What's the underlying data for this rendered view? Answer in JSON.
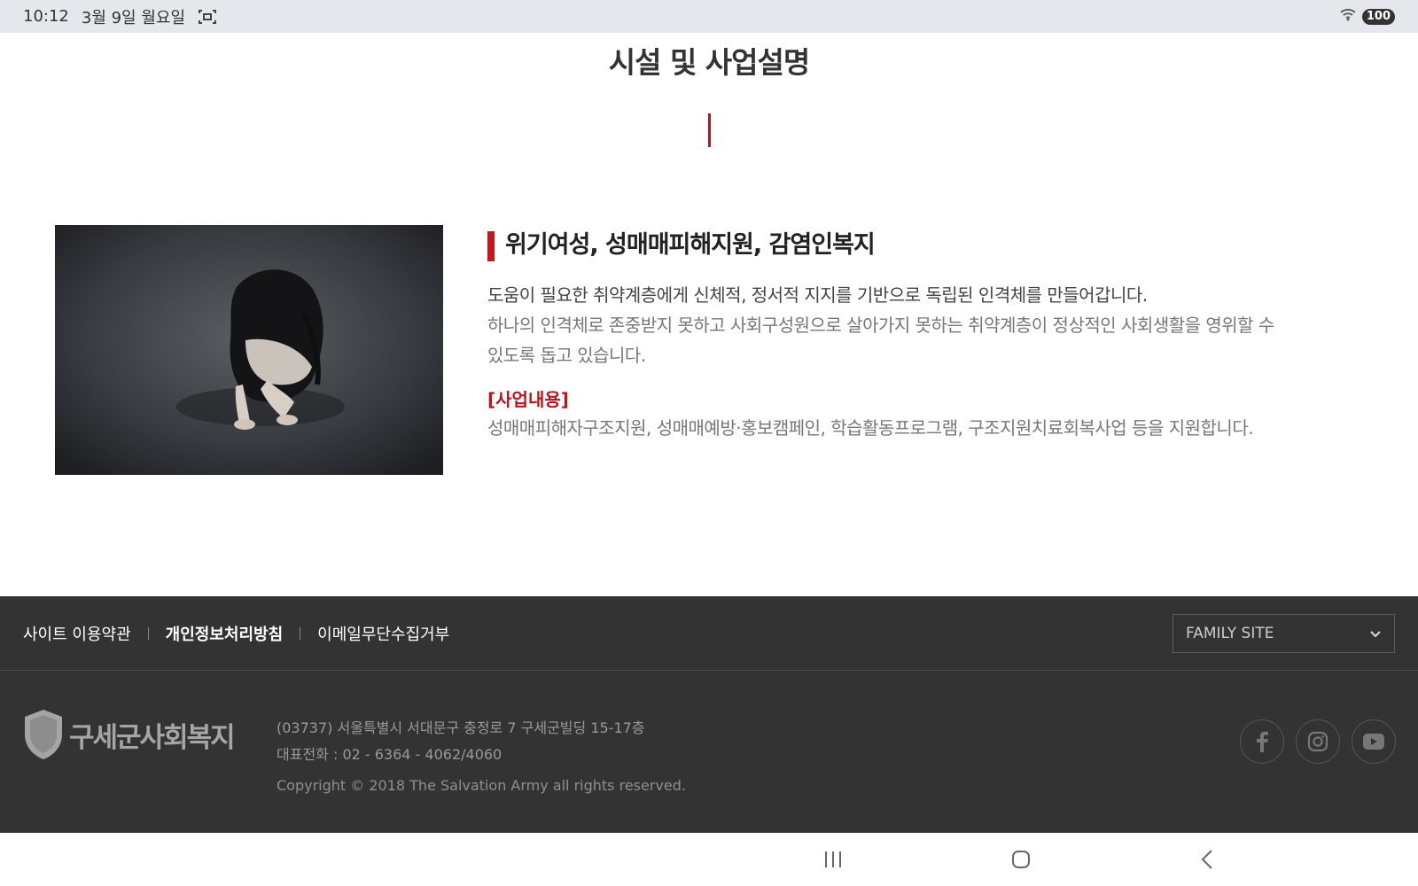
{
  "status": {
    "time": "10:12",
    "date": "3월 9일 월요일",
    "battery": "100"
  },
  "page": {
    "title": "시설 및 사업설명"
  },
  "section": {
    "heading": "위기여성, 성매매피해지원, 감염인복지",
    "lead": "도움이 필요한 취약계층에게 신체적, 정서적 지지를 기반으로 독립된 인격체를 만들어갑니다.",
    "desc_line1": "하나의 인격체로 존중받지 못하고 사회구성원으로 살아가지 못하는 취약계층이 정상적인 사회생활을 영위할 수",
    "desc_line2": "있도록 돕고 있습니다.",
    "sub_heading": "[사업내용]",
    "sub_desc": "성매매피해자구조지원, 성매매예방·홍보캠페인, 학습활동프로그램, 구조지원치료회복사업 등을 지원합니다."
  },
  "footer": {
    "links": [
      "사이트 이용약관",
      "개인정보처리방침",
      "이메일무단수집거부"
    ],
    "family_site": "FAMILY SITE",
    "logo_text": "구세군사회복지",
    "logo_emblem": "THE SALVATION ARMY",
    "address": "(03737) 서울특별시 서대문구 충정로 7 구세군빌딩 15-17층",
    "phone": "대표전화 : 02 - 6364 - 4062/4060",
    "copyright": "Copyright © 2018 The Salvation Army all rights reserved."
  },
  "icons": [
    "screenshot-icon",
    "wifi-icon",
    "facebook-icon",
    "instagram-icon",
    "youtube-icon",
    "recents-icon",
    "home-icon",
    "back-icon"
  ],
  "colors": {
    "accent": "#c8161e",
    "footer_bg": "#333334",
    "statusbar_bg": "#e6e7ec"
  }
}
